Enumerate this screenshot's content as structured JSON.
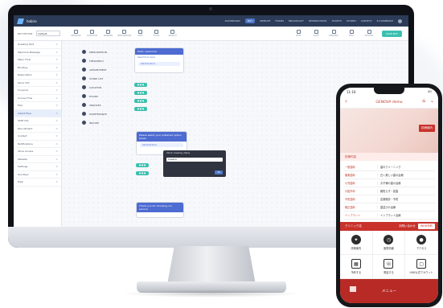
{
  "desktop": {
    "app_title": "hobiro",
    "nav": [
      "DASHBOARD",
      "BOT",
      "WEBSITE",
      "FORMS",
      "BROADCAST",
      "RESERVATIONS",
      "TICKETS",
      "STORES",
      "SURVEYS",
      "E-COMMERCE"
    ],
    "nav_active_index": 1,
    "toolbar": {
      "label": "BOT EDITOR",
      "select_value": "Default",
      "tools": [
        "MESSAGE",
        "QUESTION",
        "RANDOM",
        "INTEGRATION",
        "STEP",
        "FLOW",
        "SEARCH"
      ],
      "right_tools": [
        "VIEW",
        "SAVE",
        "PREVIEW",
        "TEST",
        "HISTORY"
      ],
      "save_label": "SAVE BOT"
    },
    "sidebar": [
      {
        "label": "Greeting Text"
      },
      {
        "label": "Welcome Message"
      },
      {
        "label": "Menu Flow"
      },
      {
        "label": "Booking"
      },
      {
        "label": "Reservation"
      },
      {
        "label": "Store Info"
      },
      {
        "label": "Coupons"
      },
      {
        "label": "Survey Flow"
      },
      {
        "label": "FAQ"
      },
      {
        "label": "Intent Flow",
        "selected": true
      },
      {
        "label": "Staff Info"
      },
      {
        "label": "Recruitment"
      },
      {
        "label": "Contact"
      },
      {
        "label": "Notifications"
      },
      {
        "label": "Store Access"
      },
      {
        "label": "Website"
      },
      {
        "label": "Settings"
      },
      {
        "label": "Goodbye"
      },
      {
        "label": "Help"
      }
    ],
    "nodes": [
      "PRESCRIPTION",
      "FREQUENCY",
      "APPOINTMENT",
      "STORE LIST",
      "LOCATION",
      "HOURS",
      "SERVICES",
      "MAINTENANCE",
      "INQUIRY"
    ],
    "cards": {
      "top": {
        "head": "Hello, welcome!",
        "body": "Select from menu",
        "pill": "Get Directions"
      },
      "mid": {
        "head": "Please select your preferred option below",
        "pill": "Get Directions"
      },
      "low": {
        "head": "Thank you for choosing our service"
      }
    },
    "popup": {
      "title": "Intent: Greeting  |  Reply",
      "select": "Question",
      "ok": "OK"
    }
  },
  "phone": {
    "time": "11:16",
    "status_right": "4G",
    "clinic_name": "GENOVA demo",
    "badge": "診療案内",
    "section": "診療内容",
    "rows": [
      {
        "k": "一般歯科",
        "v": "歯のクリーニング"
      },
      {
        "k": "審美歯科",
        "v": "白く美しい歯の治療"
      },
      {
        "k": "小児歯科",
        "v": "お子様の歯の治療"
      },
      {
        "k": "口腔外科",
        "v": "親知らず・抜歯"
      },
      {
        "k": "予防歯科",
        "v": "定期検診・予防"
      },
      {
        "k": "矯正歯科",
        "v": "歯並びの治療"
      },
      {
        "k": "インプラント",
        "v": "インプラント治療"
      }
    ],
    "bar": {
      "clinic": "クリニック名",
      "contact": "お問い合わせ",
      "book": "WEB予約"
    },
    "grid": [
      {
        "icon": "tooth-icon",
        "label": "診療案内"
      },
      {
        "icon": "clock-icon",
        "label": "医院情報"
      },
      {
        "icon": "pin-icon",
        "label": "アクセス"
      },
      {
        "icon": "calendar-icon",
        "label": "予約する"
      },
      {
        "icon": "phone-icon",
        "label": "電話する"
      },
      {
        "icon": "line-icon",
        "label": "LINE公式アカウント"
      }
    ],
    "footer": "メニュー"
  },
  "colors": {
    "accent_red": "#c8322b",
    "editor_blue": "#4e6bd1",
    "teal": "#3cc0b0"
  }
}
